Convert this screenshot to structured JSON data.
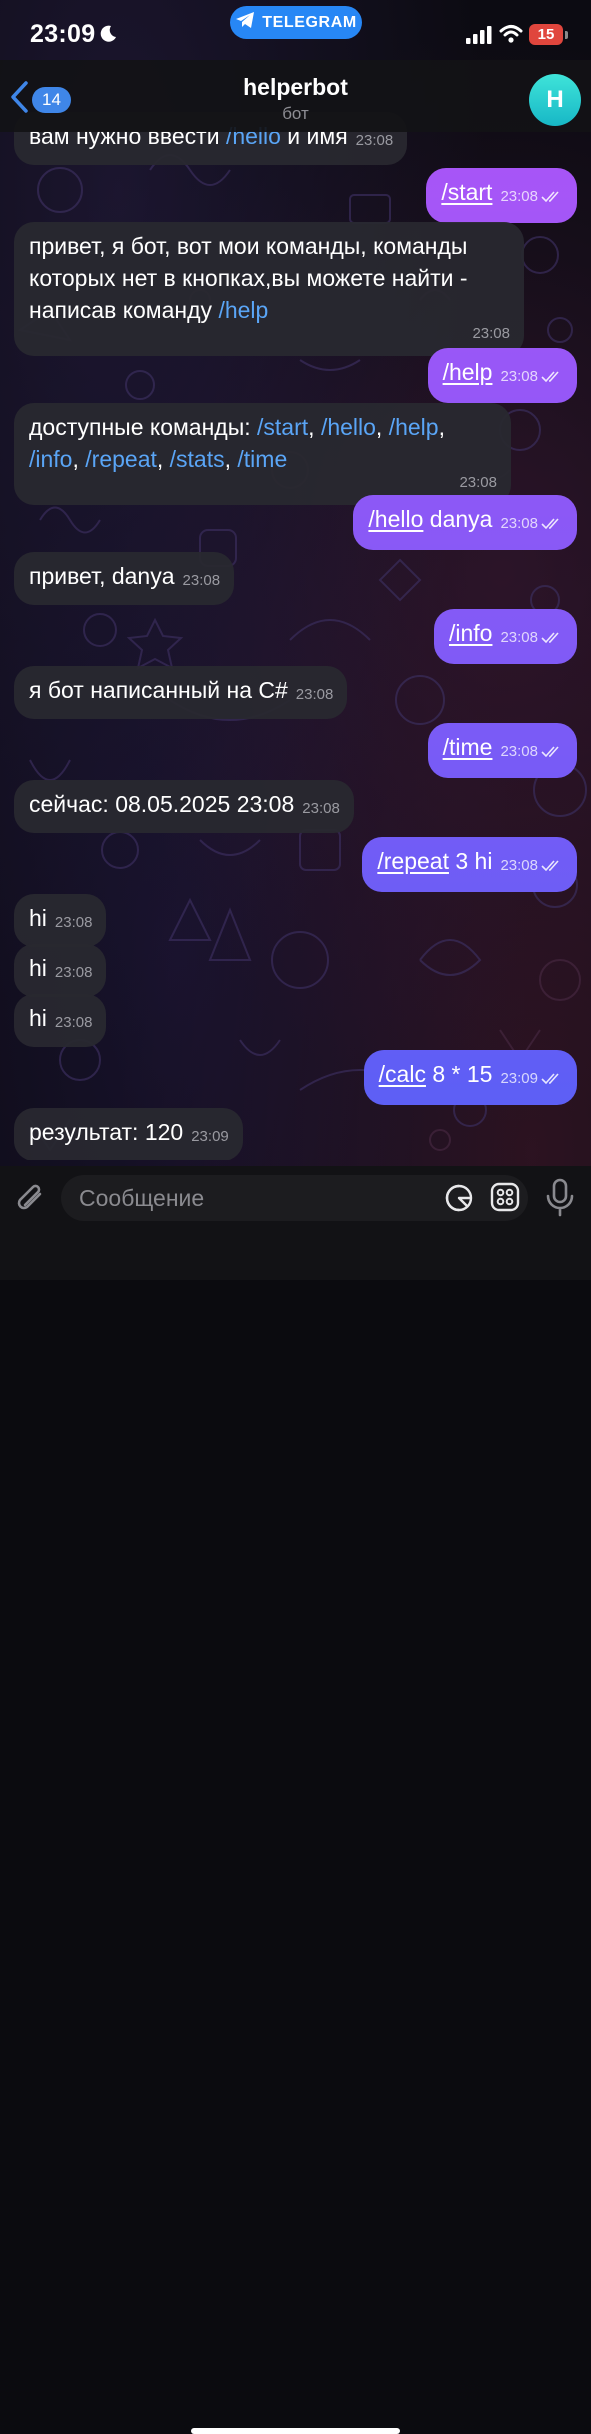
{
  "status": {
    "time": "23:09",
    "badge": "TELEGRAM",
    "battery": "15"
  },
  "header": {
    "back_count": "14",
    "title": "helperbot",
    "subtitle": "бот",
    "avatar_letter": "H"
  },
  "colors": {
    "accent": "#2787f5",
    "out_bubble_top": "#a855f7",
    "out_bubble_bottom": "#5b5ff5",
    "in_bubble": "#28282f",
    "avatar": "#27c6d0"
  },
  "messages": [
    {
      "dir": "in",
      "parts": [
        {
          "t": "вам нужно ввести "
        },
        {
          "t": "/hello",
          "cmd": true
        },
        {
          "t": " и имя"
        }
      ],
      "time": "23:08"
    },
    {
      "dir": "out",
      "parts": [
        {
          "t": "/start",
          "cmd": true
        }
      ],
      "time": "23:08"
    },
    {
      "dir": "in",
      "parts": [
        {
          "t": "привет, я бот, вот мои команды, команды которых нет в кнопках,вы можете найти - написав команду "
        },
        {
          "t": "/help",
          "cmd": true
        }
      ],
      "time": "23:08"
    },
    {
      "dir": "out",
      "parts": [
        {
          "t": "/help",
          "cmd": true
        }
      ],
      "time": "23:08"
    },
    {
      "dir": "in",
      "parts": [
        {
          "t": "доступные команды: "
        },
        {
          "t": "/start",
          "cmd": true
        },
        {
          "t": ", "
        },
        {
          "t": "/hello",
          "cmd": true
        },
        {
          "t": ", "
        },
        {
          "t": "/help",
          "cmd": true
        },
        {
          "t": ", "
        },
        {
          "t": "/info",
          "cmd": true
        },
        {
          "t": ", "
        },
        {
          "t": "/repeat",
          "cmd": true
        },
        {
          "t": ", "
        },
        {
          "t": "/stats",
          "cmd": true
        },
        {
          "t": ", "
        },
        {
          "t": "/time",
          "cmd": true
        }
      ],
      "time": "23:08"
    },
    {
      "dir": "out",
      "parts": [
        {
          "t": "/hello",
          "cmd": true
        },
        {
          "t": " danya"
        }
      ],
      "time": "23:08"
    },
    {
      "dir": "in",
      "parts": [
        {
          "t": "привет, danya"
        }
      ],
      "time": "23:08"
    },
    {
      "dir": "out",
      "parts": [
        {
          "t": "/info",
          "cmd": true
        }
      ],
      "time": "23:08"
    },
    {
      "dir": "in",
      "parts": [
        {
          "t": "я бот написанный на C#"
        }
      ],
      "time": "23:08"
    },
    {
      "dir": "out",
      "parts": [
        {
          "t": "/time",
          "cmd": true
        }
      ],
      "time": "23:08"
    },
    {
      "dir": "in",
      "parts": [
        {
          "t": "сейчас: 08.05.2025 23:08"
        }
      ],
      "time": "23:08"
    },
    {
      "dir": "out",
      "parts": [
        {
          "t": "/repeat",
          "cmd": true
        },
        {
          "t": " 3 hi"
        }
      ],
      "time": "23:08"
    },
    {
      "dir": "in",
      "parts": [
        {
          "t": "hi"
        }
      ],
      "time": "23:08"
    },
    {
      "dir": "in",
      "parts": [
        {
          "t": "hi"
        }
      ],
      "time": "23:08"
    },
    {
      "dir": "in",
      "parts": [
        {
          "t": "hi"
        }
      ],
      "time": "23:08"
    },
    {
      "dir": "out",
      "parts": [
        {
          "t": "/calc",
          "cmd": true
        },
        {
          "t": " 8 * 15"
        }
      ],
      "time": "23:09"
    },
    {
      "dir": "in",
      "parts": [
        {
          "t": "результат: 120"
        }
      ],
      "time": "23:09"
    }
  ],
  "input": {
    "placeholder": "Сообщение"
  }
}
